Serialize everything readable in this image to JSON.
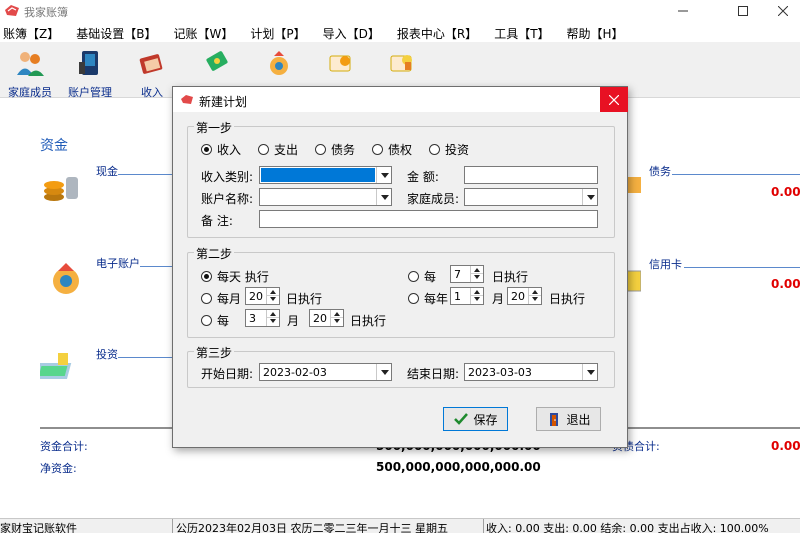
{
  "window": {
    "title": "我家账簿"
  },
  "menu": [
    "账簿【Z】",
    "基础设置【B】",
    "记账【W】",
    "计划【P】",
    "导入【D】",
    "报表中心【R】",
    "工具【T】",
    "帮助【H】"
  ],
  "toolbar": {
    "items": [
      {
        "label": "家庭成员",
        "icon": "family-members-icon"
      },
      {
        "label": "账户管理",
        "icon": "account-management-icon"
      },
      {
        "label": "收入",
        "icon": "income-icon"
      },
      {
        "label": "",
        "icon": "expense-icon"
      },
      {
        "label": "",
        "icon": "debt-icon"
      },
      {
        "label": "",
        "icon": "transfer-icon"
      },
      {
        "label": "",
        "icon": "plan-icon"
      }
    ]
  },
  "main": {
    "section_title": "资金",
    "left_links": [
      "现金",
      "电子账户",
      "投资"
    ],
    "right_links": [
      "债务",
      "信用卡"
    ],
    "right_values": [
      "0.00",
      "0.00"
    ],
    "totals": {
      "assets_label": "资金合计:",
      "net_label": "净资金:",
      "assets_value": "500,000,000,000,000.00",
      "net_value": "500,000,000,000,000.00",
      "debt_label": "负债合计:",
      "debt_value": "0.00"
    }
  },
  "statusbar": {
    "app": "家财宝记账软件",
    "date": "公历2023年02月03日 农历二零二三年一月十三  星期五",
    "summary": "收入: 0.00 支出: 0.00 结余: 0.00 支出占收入: 100.00%"
  },
  "dialog": {
    "title": "新建计划",
    "step1": {
      "label": "第一步",
      "types": [
        "收入",
        "支出",
        "债务",
        "债权",
        "投资"
      ],
      "selected_type": 0,
      "category_label": "收入类别:",
      "category_value": "",
      "amount_label": "金    额:",
      "amount_value": "",
      "account_label": "账户名称:",
      "account_value": "",
      "member_label": "家庭成员:",
      "member_value": "",
      "note_label": "备    注:",
      "note_value": ""
    },
    "step2": {
      "label": "第二步",
      "daily": "每天 执行",
      "every_prefix": "每",
      "every_days": "7",
      "every_days_suffix": "日执行",
      "monthly_prefix": "每月",
      "monthly_day": "20",
      "monthly_suffix": "日执行",
      "yearly_prefix": "每年",
      "yearly_month": "1",
      "yearly_month_suffix": "月",
      "yearly_day": "20",
      "yearly_day_suffix": "日执行",
      "everyn_prefix": "每",
      "everyn_months": "3",
      "everyn_month_suffix": "月",
      "everyn_day": "20",
      "everyn_day_suffix": "日执行"
    },
    "step3": {
      "label": "第三步",
      "start_label": "开始日期:",
      "start_value": "2023-02-03",
      "end_label": "结束日期:",
      "end_value": "2023-03-03"
    },
    "save_label": "保存",
    "exit_label": "退出"
  }
}
